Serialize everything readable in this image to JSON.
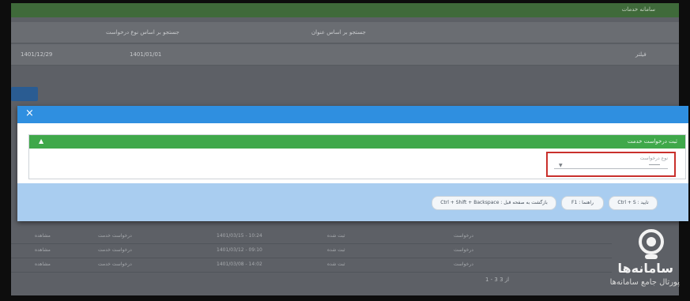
{
  "modal": {
    "close": "×",
    "panel_title": "ثبت درخواست خدمت",
    "panel_collapse": "▲",
    "field_label": "نوع درخواست",
    "field_caret": "▼",
    "buttons": [
      "Ctrl + S : تایید",
      "F1 : راهنما",
      "Ctrl + Shift + Backspace : بازگشت به صفحه قبل"
    ]
  },
  "background": {
    "top_label": "سامانه خدمات",
    "search1": "جستجو بر اساس نوع درخواست",
    "search2": "جستجو بر اساس عنوان",
    "date1": "1401/01/01",
    "date2": "1401/12/29",
    "filter": "فیلتر",
    "rows": [
      [
        "درخواست",
        "1401/03/15 - 10:24",
        "ثبت شده",
        "درخواست خدمت",
        "مشاهده"
      ],
      [
        "درخواست",
        "1401/03/12 - 09:10",
        "ثبت شده",
        "درخواست خدمت",
        "مشاهده"
      ],
      [
        "درخواست",
        "1401/03/08 - 14:02",
        "ثبت شده",
        "درخواست خدمت",
        "مشاهده"
      ]
    ],
    "pager": "1 - 3 از 3"
  },
  "watermark": {
    "name": "سامانه‌ها",
    "subtitle": "پورتال جامع سامانه‌ها"
  },
  "colors": {
    "modal_header": "#2f8fe0",
    "panel_header": "#3fa84a",
    "highlight": "#c9302c",
    "action_bar": "#a9cdf0"
  }
}
